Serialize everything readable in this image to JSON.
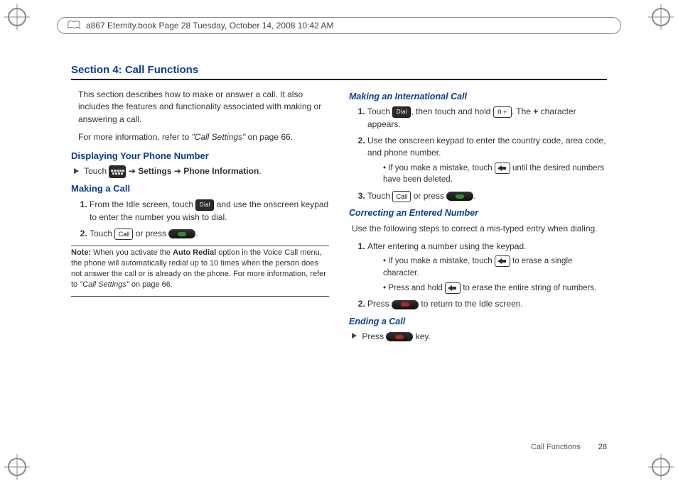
{
  "header": "a867 Eternity.book  Page 28  Tuesday, October 14, 2008  10:42 AM",
  "section_title": "Section 4: Call Functions",
  "intro_p1": "This section describes how to make or answer a call. It also includes the features and functionality associated with making or answering a call.",
  "intro_p2_a": "For more information, refer to ",
  "intro_p2_ref": "\"Call Settings\"",
  "intro_p2_b": "  on page 66.",
  "h_display": "Displaying Your Phone Number",
  "display_line_a": "Touch ",
  "display_line_b": " ➔ ",
  "display_line_settings": "Settings",
  "display_line_c": " ➔ ",
  "display_line_phone": "Phone Information",
  "h_making": "Making a Call",
  "making_1_a": "From the Idle screen, touch ",
  "making_1_b": " and use the onscreen keypad to enter the number you wish to dial.",
  "making_2_a": "Touch ",
  "making_2_b": " or press ",
  "note_label": "Note:",
  "note_body_a": " When you activate the ",
  "note_bold": "Auto Redial",
  "note_body_b": " option in the Voice Call menu, the phone will automatically redial up to 10 times when the person does not answer the call or is already on the phone. For more information, refer to ",
  "note_ref": "\"Call Settings\"",
  "note_body_c": "  on page 66.",
  "h_intl": "Making an International Call",
  "intl_1_a": "Touch ",
  "intl_1_b": ", then touch and hold ",
  "intl_key": "0 +",
  "intl_1_c": ". The ",
  "intl_plus": "+",
  "intl_1_d": " character appears.",
  "intl_2": "Use the onscreen keypad to enter the country code, area code, and phone number.",
  "intl_2_sub_a": "If you make a mistake, touch ",
  "intl_2_sub_b": " until the desired numbers have been deleted.",
  "intl_3_a": "Touch ",
  "intl_3_b": " or press ",
  "h_correct": "Correcting an Entered Number",
  "correct_intro": "Use the following steps to correct a mis-typed entry when dialing.",
  "correct_1": "After entering a number using the keypad.",
  "correct_sub1_a": "If you make a mistake, touch ",
  "correct_sub1_b": " to erase a single character.",
  "correct_sub2_a": "Press and hold ",
  "correct_sub2_b": " to erase the entire string of numbers.",
  "correct_2_a": "Press ",
  "correct_2_b": " to return to the Idle screen.",
  "h_end": "Ending a Call",
  "end_a": "Press ",
  "end_b": " key.",
  "footer_label": "Call Functions",
  "footer_page": "28",
  "icon_call_label": "Call",
  "icon_dial_label": "Dial",
  "icon_menu_label": "Menu"
}
